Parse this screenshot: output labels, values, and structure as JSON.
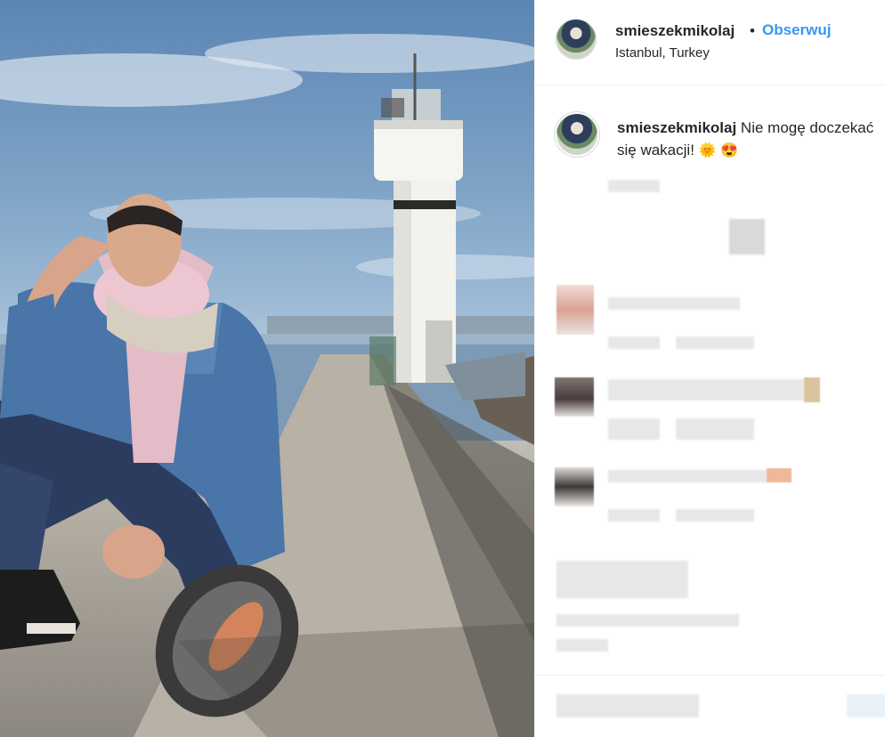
{
  "post": {
    "photo_alt": "Photo",
    "header": {
      "username": "smieszekmikolaj",
      "separator": "•",
      "follow_label": "Obserwuj",
      "location": "Istanbul, Turkey"
    },
    "caption": {
      "username": "smieszekmikolaj",
      "text_line1": " Nie mogę doczekać",
      "text_line2": "się wakacji! ",
      "emojis": [
        "🌞",
        "😍"
      ]
    }
  },
  "colors": {
    "link_blue": "#3897f0",
    "text_dark": "#262626",
    "divider": "#efefef"
  },
  "icons": [
    "avatar-image",
    "sun-emoji",
    "heart-eyes-emoji"
  ]
}
